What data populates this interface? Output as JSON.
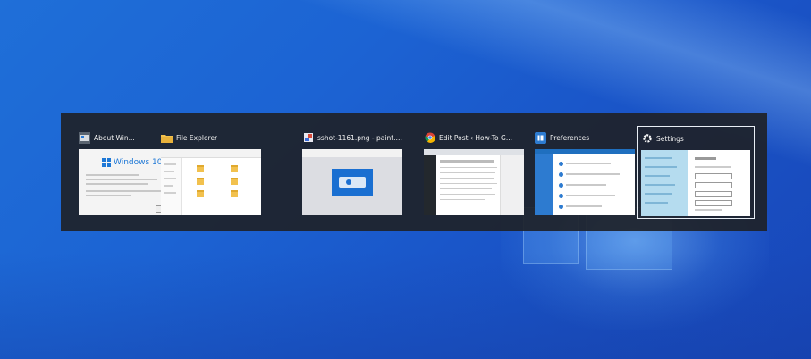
{
  "task_switcher": {
    "windows": [
      {
        "title": "About Win...",
        "icon": "about-windows-icon",
        "thumb_text": "Windows 10",
        "selected": false
      },
      {
        "title": "File Explorer",
        "icon": "folder-icon",
        "selected": false
      },
      {
        "title": "sshot-1161.png - paint.n...",
        "icon": "paint-icon",
        "selected": false
      },
      {
        "title": "Edit Post ‹ How-To G...",
        "icon": "chrome-icon",
        "selected": false
      },
      {
        "title": "Preferences",
        "icon": "pushbullet-icon",
        "selected": false
      },
      {
        "title": "Settings",
        "icon": "gear-icon",
        "selected": true
      }
    ]
  },
  "colors": {
    "desktop_blue": "#1c63d3",
    "switcher_bg": "#1e2228",
    "selection_border": "#e8eef5"
  }
}
